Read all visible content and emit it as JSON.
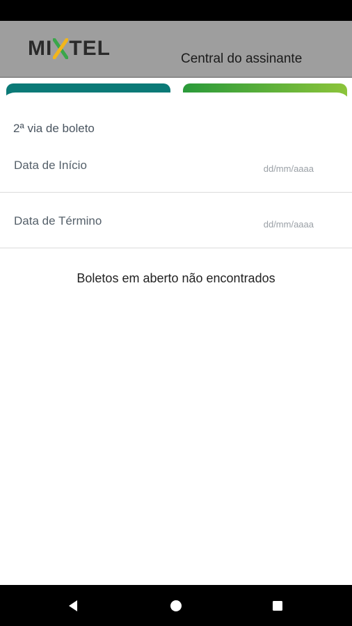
{
  "header": {
    "logo_text_left": "MI",
    "logo_text_right": "TEL",
    "logo_text_full": "MIXTEL",
    "title": "Central do assinante"
  },
  "sheet": {
    "title": "2ª via de boleto",
    "start_date": {
      "label": "Data de Início",
      "placeholder": "dd/mm/aaaa",
      "value": ""
    },
    "end_date": {
      "label": "Data de Término",
      "placeholder": "dd/mm/aaaa",
      "value": ""
    },
    "empty_message": "Boletos em aberto não encontrados"
  },
  "nav": {
    "back_icon": "back-triangle-icon",
    "home_icon": "home-circle-icon",
    "recents_icon": "recents-square-icon"
  },
  "colors": {
    "header_bg": "#9e9e9e",
    "card_teal": "#0b7a77",
    "card_green_start": "#2a9a3a",
    "card_green_end": "#8cc43a",
    "logo_dark": "#2a2a2a",
    "logo_green": "#3aa64a",
    "logo_yellow": "#f2b61b"
  }
}
